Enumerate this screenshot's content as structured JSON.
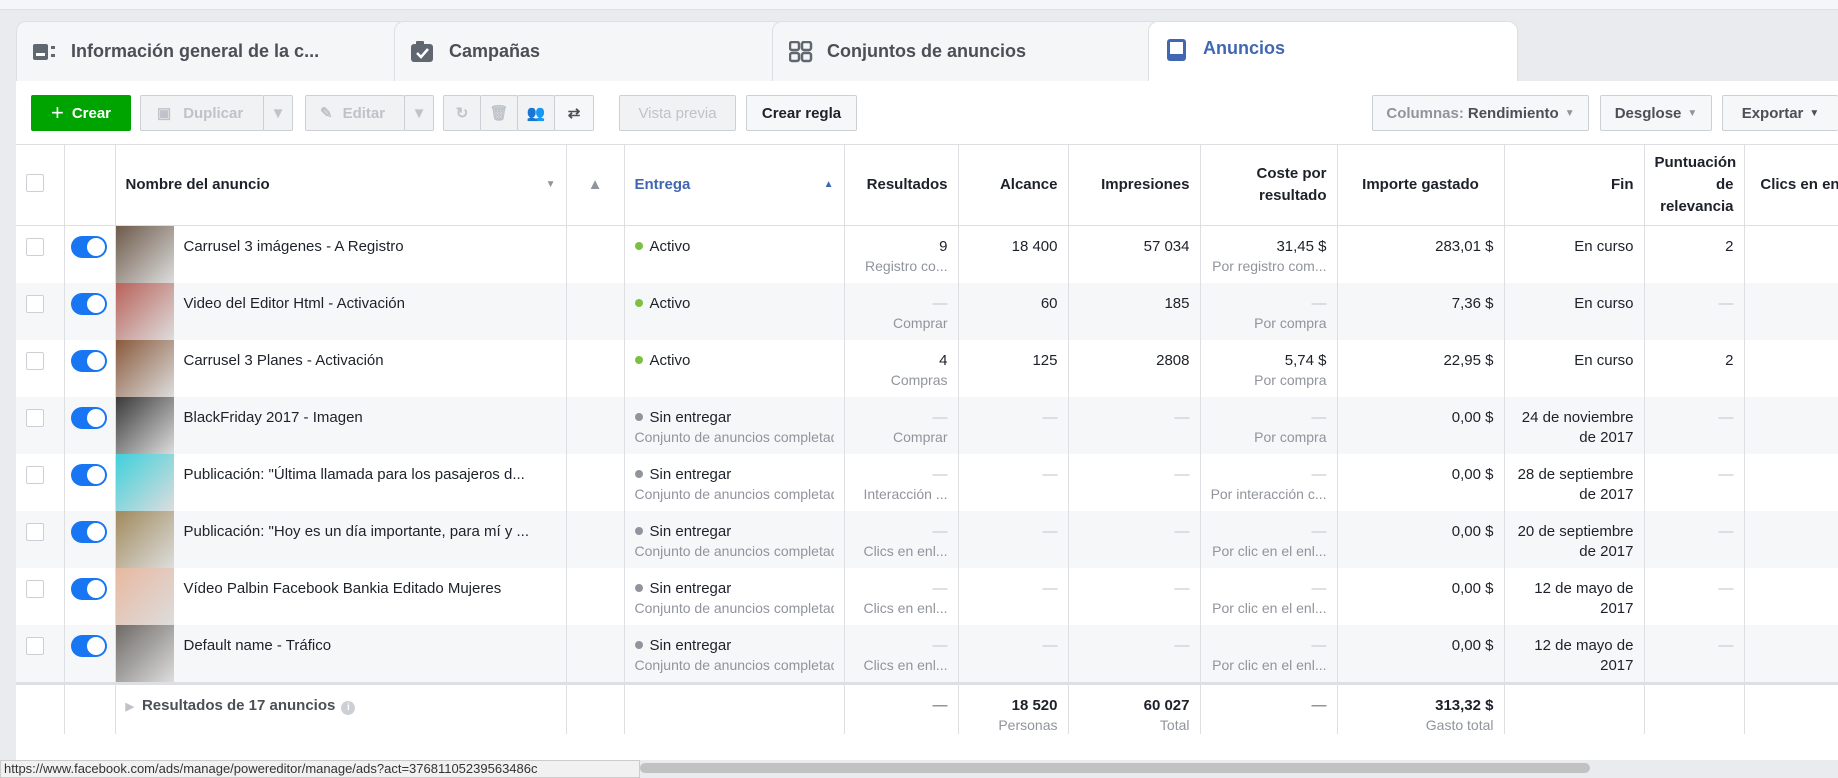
{
  "tabs": [
    {
      "label": "Información general de la c...",
      "icon": "overview-icon"
    },
    {
      "label": "Campañas",
      "icon": "campaign-icon"
    },
    {
      "label": "Conjuntos de anuncios",
      "icon": "adsets-icon"
    },
    {
      "label": "Anuncios",
      "icon": "ads-icon",
      "active": true
    }
  ],
  "toolbar": {
    "create": "Crear",
    "duplicate": "Duplicar",
    "edit": "Editar",
    "preview": "Vista previa",
    "create_rule": "Crear regla",
    "columns_prefix": "Columnas:",
    "columns_value": "Rendimiento",
    "breakdown": "Desglose",
    "export": "Exportar"
  },
  "columns": {
    "name": "Nombre del anuncio",
    "delivery": "Entrega",
    "results": "Resultados",
    "reach": "Alcance",
    "impressions": "Impresiones",
    "cost": "Coste por resultado",
    "spent": "Importe gastado",
    "end": "Fin",
    "relevance": "Puntuación de relevancia",
    "clicks": "Clics en en"
  },
  "rows": [
    {
      "name": "Carrusel 3 imágenes - A Registro",
      "status": "Activo",
      "status_sub": "",
      "results": "9",
      "results_sub": "Registro co...",
      "reach": "18 400",
      "impressions": "57 034",
      "cost": "31,45 $",
      "cost_sub": "Por registro com...",
      "spent": "283,01 $",
      "end": "En curso",
      "end2": "",
      "relevance": "2",
      "thumb": "#6d5a4a"
    },
    {
      "name": "Video del Editor Html - Activación",
      "status": "Activo",
      "status_sub": "",
      "results": "—",
      "results_sub": "Comprar",
      "reach": "60",
      "impressions": "185",
      "cost": "—",
      "cost_sub": "Por compra",
      "spent": "7,36 $",
      "end": "En curso",
      "end2": "",
      "relevance": "—",
      "thumb": "#b9625a"
    },
    {
      "name": "Carrusel 3 Planes - Activación",
      "status": "Activo",
      "status_sub": "",
      "results": "4",
      "results_sub": "Compras",
      "reach": "125",
      "impressions": "2808",
      "cost": "5,74 $",
      "cost_sub": "Por compra",
      "spent": "22,95 $",
      "end": "En curso",
      "end2": "",
      "relevance": "2",
      "thumb": "#8a5a3c"
    },
    {
      "name": "BlackFriday 2017 - Imagen",
      "status": "Sin entregar",
      "status_sub": "Conjunto de anuncios completado",
      "results": "—",
      "results_sub": "Comprar",
      "reach": "—",
      "impressions": "—",
      "cost": "—",
      "cost_sub": "Por compra",
      "spent": "0,00 $",
      "end": "24 de noviembre",
      "end2": "de 2017",
      "relevance": "—",
      "thumb": "#3a3a3a"
    },
    {
      "name": "Publicación: \"Última llamada para los pasajeros d...",
      "status": "Sin entregar",
      "status_sub": "Conjunto de anuncios completado",
      "results": "—",
      "results_sub": "Interacción ...",
      "reach": "—",
      "impressions": "—",
      "cost": "—",
      "cost_sub": "Por interacción c...",
      "spent": "0,00 $",
      "end": "28 de septiembre",
      "end2": "de 2017",
      "relevance": "—",
      "thumb": "#3fd0dc"
    },
    {
      "name": "Publicación: \"Hoy es un día importante, para mí y ...",
      "status": "Sin entregar",
      "status_sub": "Conjunto de anuncios completado",
      "results": "—",
      "results_sub": "Clics en enl...",
      "reach": "—",
      "impressions": "—",
      "cost": "—",
      "cost_sub": "Por clic en el enl...",
      "spent": "0,00 $",
      "end": "20 de septiembre",
      "end2": "de 2017",
      "relevance": "—",
      "thumb": "#a08a5c"
    },
    {
      "name": "Vídeo Palbin Facebook Bankia Editado Mujeres",
      "status": "Sin entregar",
      "status_sub": "Conjunto de anuncios completado",
      "results": "—",
      "results_sub": "Clics en enl...",
      "reach": "—",
      "impressions": "—",
      "cost": "—",
      "cost_sub": "Por clic en el enl...",
      "spent": "0,00 $",
      "end": "12 de mayo de",
      "end2": "2017",
      "relevance": "—",
      "thumb": "#e8b8a0"
    },
    {
      "name": "Default name - Tráfico",
      "status": "Sin entregar",
      "status_sub": "Conjunto de anuncios completado",
      "results": "—",
      "results_sub": "Clics en enl...",
      "reach": "—",
      "impressions": "—",
      "cost": "—",
      "cost_sub": "Por clic en el enl...",
      "spent": "0,00 $",
      "end": "12 de mayo de",
      "end2": "2017",
      "relevance": "—",
      "thumb": "#6e6a66"
    }
  ],
  "footer": {
    "label": "Resultados de 17 anuncios",
    "results": "—",
    "reach": "18 520",
    "reach_sub": "Personas",
    "impressions": "60 027",
    "impressions_sub": "Total",
    "cost": "—",
    "spent": "313,32 $",
    "spent_sub": "Gasto total"
  },
  "statusbar": "https://www.facebook.com/ads/manage/powereditor/manage/ads?act=37681105239563486c",
  "colors": {
    "active": "#7bc043",
    "inactive": "#90949c",
    "accent": "#4267b2",
    "create": "#00a400"
  }
}
